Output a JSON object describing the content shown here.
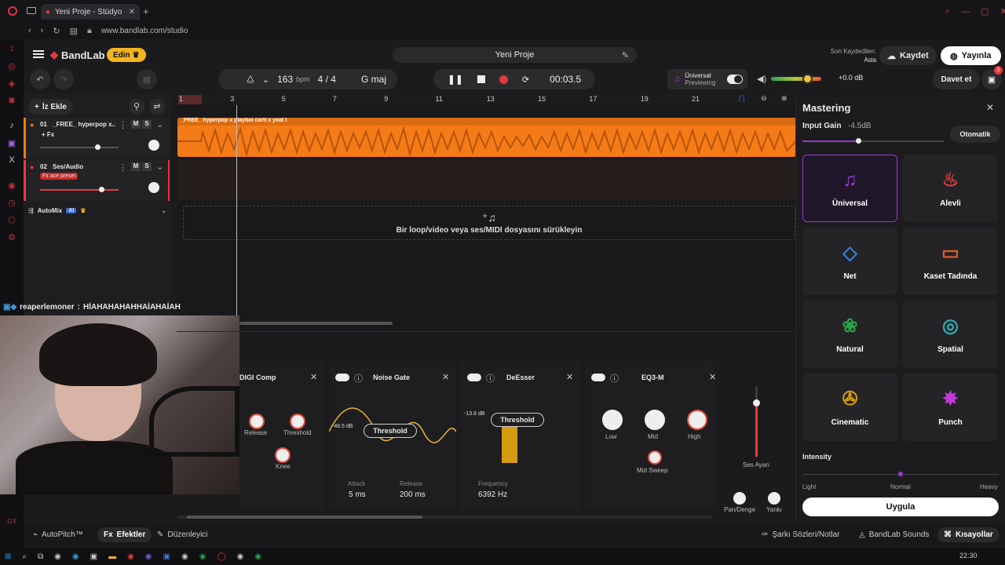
{
  "browser": {
    "tab_title": "Yeni Proje - Stüdyo",
    "url": "www.bandlab.com/studio",
    "new_tab": "+"
  },
  "header": {
    "logo": "BandLab",
    "edit_label": "Edin",
    "project_title": "Yeni Proje",
    "last_saved_label": "Son Kaydedilen:",
    "last_saved_value": "Asla",
    "save_label": "Kaydet",
    "publish_label": "Yayınla",
    "invite_label": "Davet et",
    "notif_count": "3"
  },
  "transport": {
    "bpm": "163",
    "bpm_unit": "bpm",
    "time_sig": "4 / 4",
    "key": "G maj",
    "time": "00:03.5",
    "master_preset": "Üniversal",
    "master_state": "Previewing",
    "volume_db": "+0.0 dB",
    "volume_level": 0.72
  },
  "tracks": {
    "add_label": "İz Ekle",
    "items": [
      {
        "index": "01",
        "name": "_FREE_ hyperpop x...",
        "fx": "+ Fx",
        "mute": "M",
        "solo": "S",
        "volume": 0.9
      },
      {
        "index": "02",
        "name": "Ses/Audio",
        "fx": "Fx ace preset",
        "mute": "M",
        "solo": "S",
        "volume": 0.95
      }
    ],
    "automix_label": "AutoMix",
    "automix_badge": "AI"
  },
  "timeline": {
    "ruler": [
      "1",
      "3",
      "5",
      "7",
      "9",
      "11",
      "13",
      "15",
      "17",
      "19",
      "21"
    ],
    "clip_name": "_FREE_ hyperpop x playboi carti x yeat t",
    "drop_text": "Bir loop/video veya ses/MIDI dosyasını sürükleyin",
    "chat_user": "reaperlemoner",
    "chat_msg": "HİAHAHAHAHHAİAHAİAH"
  },
  "effects": {
    "comp": {
      "title": "DIGI Comp",
      "knobs": [
        "Release",
        "Threshold",
        "Knee"
      ]
    },
    "gate": {
      "title": "Noise Gate",
      "db": "-48.5 dB",
      "param": "Threshold",
      "attack_label": "Attack",
      "attack": "5 ms",
      "release_label": "Release",
      "release": "200 ms"
    },
    "deesser": {
      "title": "DeEsser",
      "db": "-13.8 dB",
      "param": "Threshold",
      "freq_label": "Frequency",
      "freq": "6392 Hz"
    },
    "eq": {
      "title": "EQ3-M",
      "knobs": [
        "Low",
        "Mid",
        "High"
      ],
      "sweep": "Mid Sweep"
    },
    "ses_ayari": "Ses Ayarı",
    "pan": "Pan/Denge",
    "yanki": "Yankı"
  },
  "mastering": {
    "title": "Mastering",
    "input_gain_label": "Input Gain",
    "input_gain": "-4.5dB",
    "auto_label": "Otomatik",
    "presets": [
      "Üniversal",
      "Alevli",
      "Net",
      "Kaset Tadında",
      "Natural",
      "Spatial",
      "Cinematic",
      "Punch"
    ],
    "intensity_label": "Intensity",
    "intensity_levels": [
      "Light",
      "Normal",
      "Heavy"
    ],
    "intensity": 0.5,
    "apply_label": "Uygula"
  },
  "bottom": {
    "autopitch": "AutoPitch™",
    "effects": "Efektler",
    "editor": "Düzenleyici",
    "lyrics": "Şarkı Sözleri/Notlar",
    "sounds": "BandLab Sounds",
    "shortcuts": "Kısayollar"
  },
  "taskbar": {
    "time": "22:30"
  },
  "colors": {
    "accent": "#f47b17",
    "brand": "#e33b3b",
    "select": "#9a36d6"
  }
}
